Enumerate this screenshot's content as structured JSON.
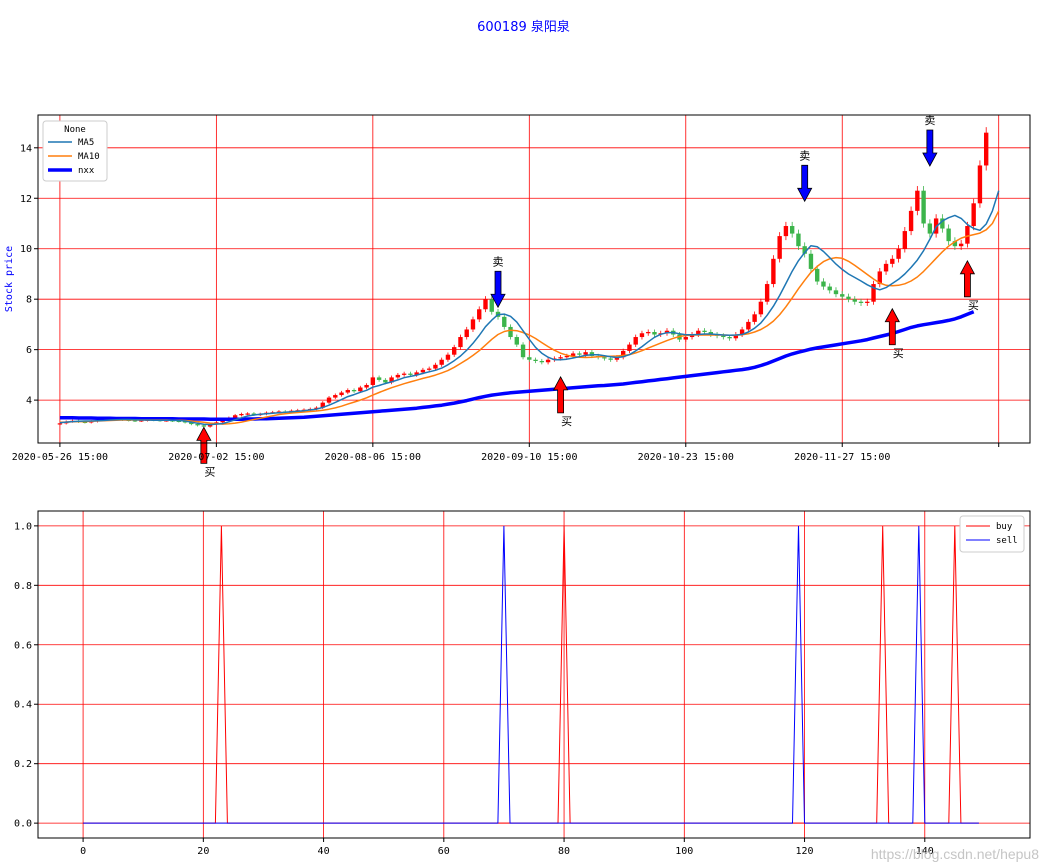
{
  "figure": {
    "title": "600189 泉阳泉",
    "title_color": "#0000ff",
    "watermark": "https://blog.csdn.net/hepu8"
  },
  "chart_data": [
    {
      "type": "candlestick",
      "ylabel": "Stock price",
      "ylabel_color": "#0000ff",
      "grid": true,
      "grid_color": "#ff0000",
      "ylim": [
        2.3,
        15.3
      ],
      "yticks": [
        4,
        6,
        8,
        10,
        12,
        14
      ],
      "xlim": [
        -3.5,
        155
      ],
      "xticks": [
        {
          "x": 0,
          "label": "2020-05-26 15:00"
        },
        {
          "x": 25,
          "label": "2020-07-02 15:00"
        },
        {
          "x": 50,
          "label": "2020-08-06 15:00"
        },
        {
          "x": 75,
          "label": "2020-09-10 15:00"
        },
        {
          "x": 100,
          "label": "2020-10-23 15:00"
        },
        {
          "x": 125,
          "label": "2020-11-27 15:00"
        },
        {
          "x": 150,
          "label": ""
        }
      ],
      "up_color": "#ff0000",
      "down_color": "#3cb44b",
      "close": [
        3.08,
        3.15,
        3.18,
        3.14,
        3.12,
        3.16,
        3.2,
        3.22,
        3.25,
        3.24,
        3.22,
        3.2,
        3.18,
        3.2,
        3.22,
        3.21,
        3.19,
        3.2,
        3.18,
        3.16,
        3.12,
        3.05,
        3.0,
        2.95,
        3.05,
        3.12,
        3.2,
        3.3,
        3.4,
        3.45,
        3.47,
        3.42,
        3.45,
        3.5,
        3.52,
        3.55,
        3.52,
        3.58,
        3.6,
        3.62,
        3.65,
        3.7,
        3.9,
        4.1,
        4.2,
        4.3,
        4.4,
        4.35,
        4.5,
        4.6,
        4.9,
        4.8,
        4.7,
        4.9,
        5.0,
        5.05,
        5.0,
        5.1,
        5.2,
        5.25,
        5.4,
        5.6,
        5.8,
        6.1,
        6.5,
        6.8,
        7.2,
        7.6,
        8.0,
        7.5,
        7.3,
        6.9,
        6.5,
        6.2,
        5.7,
        5.6,
        5.55,
        5.5,
        5.6,
        5.65,
        5.7,
        5.75,
        5.85,
        5.8,
        5.9,
        5.75,
        5.7,
        5.65,
        5.6,
        5.7,
        5.95,
        6.2,
        6.5,
        6.65,
        6.7,
        6.6,
        6.65,
        6.75,
        6.6,
        6.4,
        6.5,
        6.6,
        6.75,
        6.7,
        6.6,
        6.55,
        6.5,
        6.45,
        6.6,
        6.8,
        7.1,
        7.4,
        7.9,
        8.6,
        9.6,
        10.5,
        10.9,
        10.6,
        10.1,
        9.8,
        9.2,
        8.7,
        8.5,
        8.35,
        8.2,
        8.1,
        8.0,
        7.9,
        7.85,
        7.9,
        8.6,
        9.1,
        9.4,
        9.6,
        10.0,
        10.7,
        11.5,
        12.3,
        11.0,
        10.6,
        11.2,
        10.8,
        10.3,
        10.1,
        10.2,
        10.9,
        11.8,
        13.3,
        14.6
      ],
      "ma5": [
        3.1,
        3.13,
        3.15,
        3.16,
        3.17,
        3.17,
        3.18,
        3.19,
        3.21,
        3.22,
        3.23,
        3.23,
        3.22,
        3.21,
        3.21,
        3.2,
        3.2,
        3.2,
        3.2,
        3.19,
        3.17,
        3.13,
        3.08,
        3.04,
        3.03,
        3.05,
        3.07,
        3.14,
        3.22,
        3.3,
        3.37,
        3.41,
        3.44,
        3.46,
        3.48,
        3.5,
        3.52,
        3.54,
        3.56,
        3.58,
        3.61,
        3.64,
        3.71,
        3.8,
        3.91,
        4.02,
        4.14,
        4.22,
        4.31,
        4.39,
        4.51,
        4.58,
        4.66,
        4.72,
        4.8,
        4.89,
        4.94,
        4.99,
        5.06,
        5.12,
        5.18,
        5.27,
        5.4,
        5.56,
        5.75,
        5.98,
        6.25,
        6.56,
        6.91,
        7.17,
        7.39,
        7.41,
        7.32,
        7.09,
        6.75,
        6.41,
        6.09,
        5.86,
        5.7,
        5.6,
        5.6,
        5.62,
        5.67,
        5.72,
        5.77,
        5.8,
        5.8,
        5.76,
        5.72,
        5.69,
        5.72,
        5.8,
        5.95,
        6.12,
        6.31,
        6.49,
        6.61,
        6.67,
        6.68,
        6.63,
        6.59,
        6.59,
        6.6,
        6.62,
        6.62,
        6.6,
        6.58,
        6.57,
        6.58,
        6.6,
        6.7,
        6.85,
        7.06,
        7.36,
        7.72,
        8.15,
        8.62,
        9.11,
        9.52,
        9.85,
        10.12,
        10.08,
        9.89,
        9.65,
        9.39,
        9.18,
        9.0,
        8.86,
        8.72,
        8.57,
        8.45,
        8.37,
        8.46,
        8.62,
        8.79,
        9.0,
        9.26,
        9.55,
        9.92,
        10.38,
        10.87,
        11.1,
        11.23,
        11.32,
        11.2,
        10.96,
        10.8,
        10.73,
        10.98,
        11.5,
        12.3
      ],
      "ma10": [
        3.12,
        3.13,
        3.14,
        3.15,
        3.15,
        3.16,
        3.17,
        3.18,
        3.19,
        3.2,
        3.21,
        3.21,
        3.21,
        3.21,
        3.21,
        3.21,
        3.21,
        3.21,
        3.2,
        3.2,
        3.19,
        3.17,
        3.15,
        3.12,
        3.09,
        3.07,
        3.05,
        3.06,
        3.09,
        3.13,
        3.18,
        3.23,
        3.28,
        3.33,
        3.38,
        3.43,
        3.46,
        3.49,
        3.51,
        3.53,
        3.55,
        3.57,
        3.6,
        3.64,
        3.69,
        3.76,
        3.84,
        3.92,
        4.0,
        4.09,
        4.2,
        4.3,
        4.4,
        4.49,
        4.57,
        4.65,
        4.72,
        4.79,
        4.86,
        4.92,
        4.99,
        5.08,
        5.17,
        5.3,
        5.45,
        5.6,
        5.77,
        5.96,
        6.18,
        6.41,
        6.6,
        6.72,
        6.77,
        6.75,
        6.68,
        6.58,
        6.44,
        6.28,
        6.12,
        5.98,
        5.86,
        5.78,
        5.73,
        5.7,
        5.69,
        5.7,
        5.72,
        5.73,
        5.74,
        5.75,
        5.77,
        5.8,
        5.87,
        5.96,
        6.06,
        6.16,
        6.26,
        6.36,
        6.45,
        6.52,
        6.56,
        6.58,
        6.58,
        6.58,
        6.58,
        6.58,
        6.58,
        6.57,
        6.57,
        6.59,
        6.63,
        6.7,
        6.8,
        6.94,
        7.13,
        7.39,
        7.7,
        8.05,
        8.41,
        8.75,
        9.06,
        9.3,
        9.49,
        9.6,
        9.65,
        9.62,
        9.5,
        9.34,
        9.16,
        8.98,
        8.8,
        8.64,
        8.55,
        8.53,
        8.55,
        8.61,
        8.72,
        8.88,
        9.1,
        9.36,
        9.62,
        9.88,
        10.1,
        10.28,
        10.42,
        10.5,
        10.56,
        10.62,
        10.75,
        11.0,
        11.5
      ],
      "nxx": [
        3.3,
        3.3,
        3.3,
        3.29,
        3.29,
        3.29,
        3.28,
        3.28,
        3.28,
        3.27,
        3.27,
        3.27,
        3.27,
        3.26,
        3.26,
        3.26,
        3.26,
        3.26,
        3.26,
        3.25,
        3.25,
        3.25,
        3.25,
        3.25,
        3.24,
        3.24,
        3.24,
        3.24,
        3.24,
        3.24,
        3.25,
        3.25,
        3.26,
        3.26,
        3.27,
        3.28,
        3.29,
        3.3,
        3.31,
        3.32,
        3.34,
        3.36,
        3.38,
        3.4,
        3.42,
        3.44,
        3.46,
        3.48,
        3.5,
        3.52,
        3.54,
        3.56,
        3.58,
        3.6,
        3.62,
        3.64,
        3.66,
        3.68,
        3.71,
        3.74,
        3.77,
        3.8,
        3.84,
        3.88,
        3.93,
        3.98,
        4.04,
        4.1,
        4.15,
        4.2,
        4.23,
        4.26,
        4.29,
        4.31,
        4.33,
        4.35,
        4.37,
        4.39,
        4.41,
        4.43,
        4.45,
        4.47,
        4.49,
        4.51,
        4.53,
        4.55,
        4.57,
        4.58,
        4.6,
        4.62,
        4.64,
        4.67,
        4.7,
        4.73,
        4.76,
        4.79,
        4.82,
        4.85,
        4.88,
        4.91,
        4.94,
        4.97,
        5.0,
        5.03,
        5.06,
        5.09,
        5.12,
        5.15,
        5.18,
        5.21,
        5.25,
        5.3,
        5.37,
        5.45,
        5.55,
        5.65,
        5.75,
        5.83,
        5.9,
        5.96,
        6.02,
        6.07,
        6.11,
        6.15,
        6.19,
        6.23,
        6.27,
        6.31,
        6.35,
        6.4,
        6.46,
        6.52,
        6.58,
        6.64,
        6.72,
        6.8,
        6.88,
        6.94,
        6.99,
        7.03,
        7.07,
        7.11,
        7.16,
        7.22,
        7.3,
        7.4,
        7.5
      ],
      "legend": {
        "title": "None",
        "location": "upper left",
        "items": [
          {
            "label": "MA5",
            "color": "#1f77b4",
            "width": 1.5
          },
          {
            "label": "MA10",
            "color": "#ff7f0e",
            "width": 1.5
          },
          {
            "label": "nxx",
            "color": "#0000ff",
            "width": 3.5
          }
        ]
      },
      "signals": [
        {
          "type": "buy",
          "x": 23,
          "y": 3.0,
          "text": "买",
          "color": "#ff0000"
        },
        {
          "type": "sell",
          "x": 70,
          "y": 7.6,
          "text": "卖",
          "color": "#0000ff"
        },
        {
          "type": "buy",
          "x": 80,
          "y": 5.0,
          "text": "买",
          "color": "#ff0000"
        },
        {
          "type": "sell",
          "x": 119,
          "y": 11.8,
          "text": "卖",
          "color": "#0000ff"
        },
        {
          "type": "buy",
          "x": 133,
          "y": 7.7,
          "text": "买",
          "color": "#ff0000"
        },
        {
          "type": "sell",
          "x": 139,
          "y": 13.2,
          "text": "卖",
          "color": "#0000ff"
        },
        {
          "type": "buy",
          "x": 145,
          "y": 9.6,
          "text": "买",
          "color": "#ff0000"
        }
      ]
    },
    {
      "type": "line",
      "grid": true,
      "grid_color": "#ff0000",
      "xlim": [
        -7.5,
        157.5
      ],
      "ylim": [
        -0.05,
        1.05
      ],
      "xticks": [
        0,
        20,
        40,
        60,
        80,
        100,
        120,
        140
      ],
      "yticks": [
        0.0,
        0.2,
        0.4,
        0.6,
        0.8,
        1.0
      ],
      "ytick_labels": [
        "0.0",
        "0.2",
        "0.4",
        "0.6",
        "0.8",
        "1.0"
      ],
      "n_points": 150,
      "series": [
        {
          "name": "buy",
          "color": "#ff0000",
          "spikes_at": [
            23,
            80,
            133,
            145
          ]
        },
        {
          "name": "sell",
          "color": "#0000ff",
          "spikes_at": [
            70,
            119,
            139
          ]
        }
      ],
      "legend_location": "upper right"
    }
  ]
}
